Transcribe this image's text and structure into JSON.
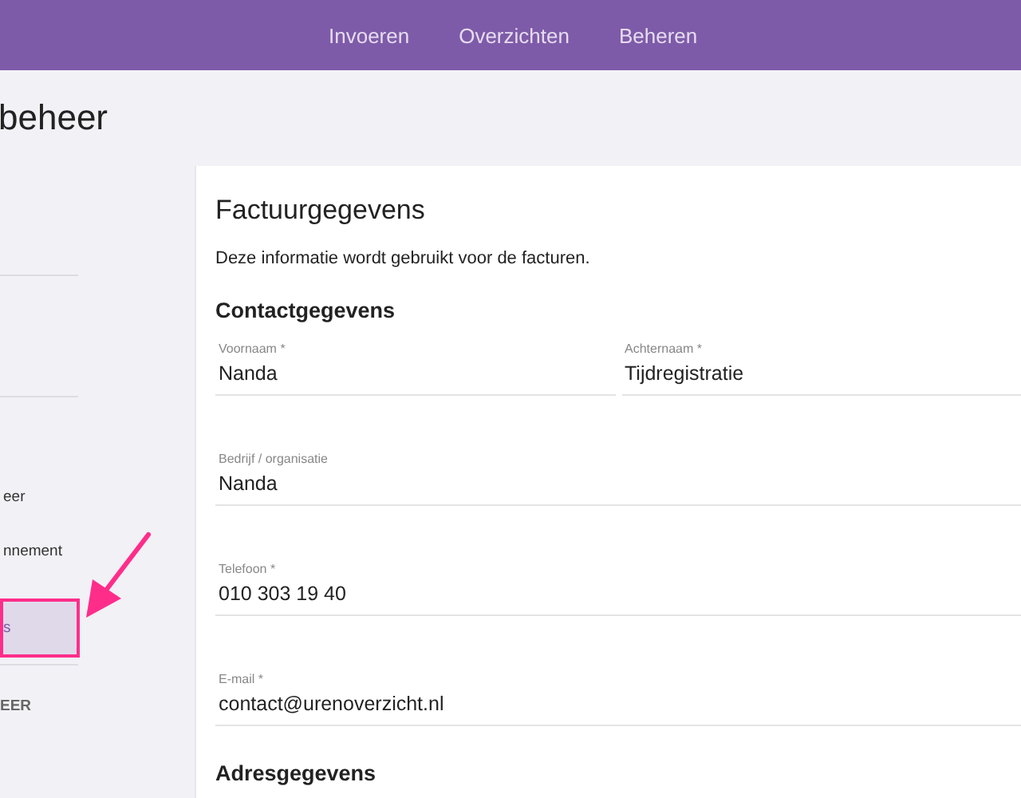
{
  "nav": {
    "items": [
      {
        "label": "Invoeren"
      },
      {
        "label": "Overzichten"
      },
      {
        "label": "Beheren"
      }
    ]
  },
  "page_title": "beheer",
  "sidebar": {
    "items": [
      {
        "label": "eer",
        "selected": false
      },
      {
        "label": "nnement",
        "selected": false
      },
      {
        "label": "s",
        "selected": true
      }
    ],
    "section_heading": "EER"
  },
  "card": {
    "title": "Factuurgegevens",
    "description": "Deze informatie wordt gebruikt voor de facturen.",
    "section": "Contactgegevens",
    "rows": [
      [
        {
          "label": "Voornaam *",
          "value": "Nanda"
        },
        {
          "label": "Achternaam *",
          "value": "Tijdregistratie"
        }
      ],
      [
        {
          "label": "Bedrijf / organisatie",
          "value": "Nanda"
        }
      ],
      [
        {
          "label": "Telefoon *",
          "value": "010 303 19 40"
        }
      ],
      [
        {
          "label": "E-mail *",
          "value": "contact@urenoverzicht.nl"
        }
      ]
    ],
    "next_section": "Adresgegevens"
  }
}
